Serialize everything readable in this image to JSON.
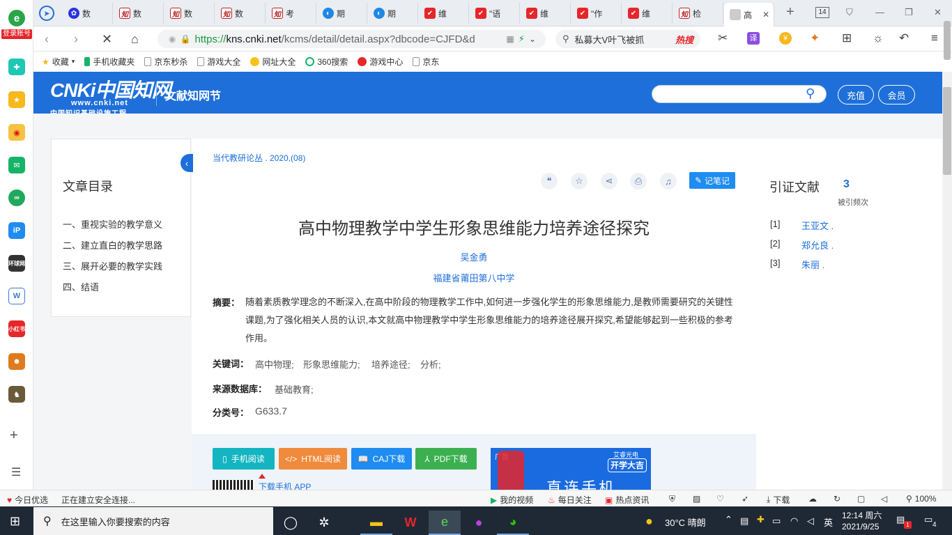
{
  "sidebar": {
    "login_label": "登录账号",
    "items": [
      "mail-icon",
      "star-icon",
      "weibo-icon",
      "message-icon",
      "link-icon",
      "ip-icon",
      "news-icon",
      "word-icon",
      "xiaohongshu-icon",
      "game-icon",
      "pubg-icon"
    ],
    "news_label": "环球网",
    "xhs_label": "小红书"
  },
  "tabs": [
    {
      "label": "数",
      "icon": "baidu"
    },
    {
      "label": "数",
      "icon": "zhi"
    },
    {
      "label": "数",
      "icon": "zhi"
    },
    {
      "label": "数",
      "icon": "zhi"
    },
    {
      "label": "考",
      "icon": "zhi"
    },
    {
      "label": "期",
      "icon": "qi"
    },
    {
      "label": "期",
      "icon": "qi"
    },
    {
      "label": "维",
      "icon": "red"
    },
    {
      "label": "\"语",
      "icon": "red"
    },
    {
      "label": "维",
      "icon": "red"
    },
    {
      "label": "\"作",
      "icon": "red"
    },
    {
      "label": "维",
      "icon": "red"
    },
    {
      "label": "检",
      "icon": "zhi"
    },
    {
      "label": "高",
      "icon": "blank"
    }
  ],
  "tab_count": "14",
  "address": {
    "proto": "https://",
    "host": "kns.cnki.net",
    "path": "/kcms/detail/detail.aspx?dbcode=CJFD&d"
  },
  "search": {
    "text": "私募大V叶飞被抓",
    "hot": "热搜"
  },
  "bookmarks": [
    "收藏",
    "手机收藏夹",
    "京东秒杀",
    "游戏大全",
    "网址大全",
    "360搜索",
    "游戏中心",
    "京东"
  ],
  "cnki": {
    "logo_text": "CNKi中国知网",
    "logo_url": "www.cnki.net",
    "logo_sub": "中国知识基础设施工程",
    "brand": "文献知网节",
    "recharge": "充值",
    "member": "会员"
  },
  "toc": {
    "title": "文章目录",
    "items": [
      "一、重视实验的教学意义",
      "二、建立直白的教学思路",
      "三、展开必要的教学实践",
      "四、结语"
    ]
  },
  "article": {
    "source": "当代教研论丛 . 2020,(08)",
    "note_label": "记笔记",
    "title": "高中物理教学中学生形象思维能力培养途径探究",
    "author": "吴金勇",
    "org": "福建省莆田第八中学",
    "abstract_label": "摘要：",
    "abstract": "随着素质教学理念的不断深入,在高中阶段的物理教学工作中,如何进一步强化学生的形象思维能力,是教师需要研究的关键性课题,为了强化相关人员的认识,本文就高中物理教学中学生形象思维能力的培养途径展开探究,希望能够起到一些积极的参考作用。",
    "keywords_label": "关键词：",
    "keywords": [
      "高中物理;",
      "形象思维能力;",
      "培养途径;",
      "分析;"
    ],
    "db_label": "来源数据库：",
    "db": "基础教育;",
    "class_label": "分类号：",
    "class": "G633.7"
  },
  "downloads": {
    "mobile": "手机阅读",
    "html": "HTML阅读",
    "caj": "CAJ下载",
    "pdf": "PDF下载",
    "app": "下载手机 APP",
    "ad_label": "广告",
    "ad_brand": "艾睿光电",
    "ad_slogan": "开学大吉",
    "ad_text": "直连手机"
  },
  "citations": {
    "title": "引证文献",
    "count": "3",
    "count_label": "被引频次",
    "items": [
      {
        "idx": "[1]",
        "name": "王亚文 ."
      },
      {
        "idx": "[2]",
        "name": "郑允良 ."
      },
      {
        "idx": "[3]",
        "name": "朱丽 ."
      }
    ]
  },
  "status": {
    "left1": "今日优选",
    "left2": "正在建立安全连接...",
    "video": "我的视频",
    "daily": "每日关注",
    "hot": "热点资讯",
    "download": "下载",
    "zoom": "100%"
  },
  "taskbar": {
    "search_placeholder": "在这里输入你要搜索的内容",
    "weather": "30°C 晴朗",
    "ime": "英",
    "time": "12:14 周六",
    "date": "2021/9/25",
    "notif": "4",
    "badge": "1"
  }
}
